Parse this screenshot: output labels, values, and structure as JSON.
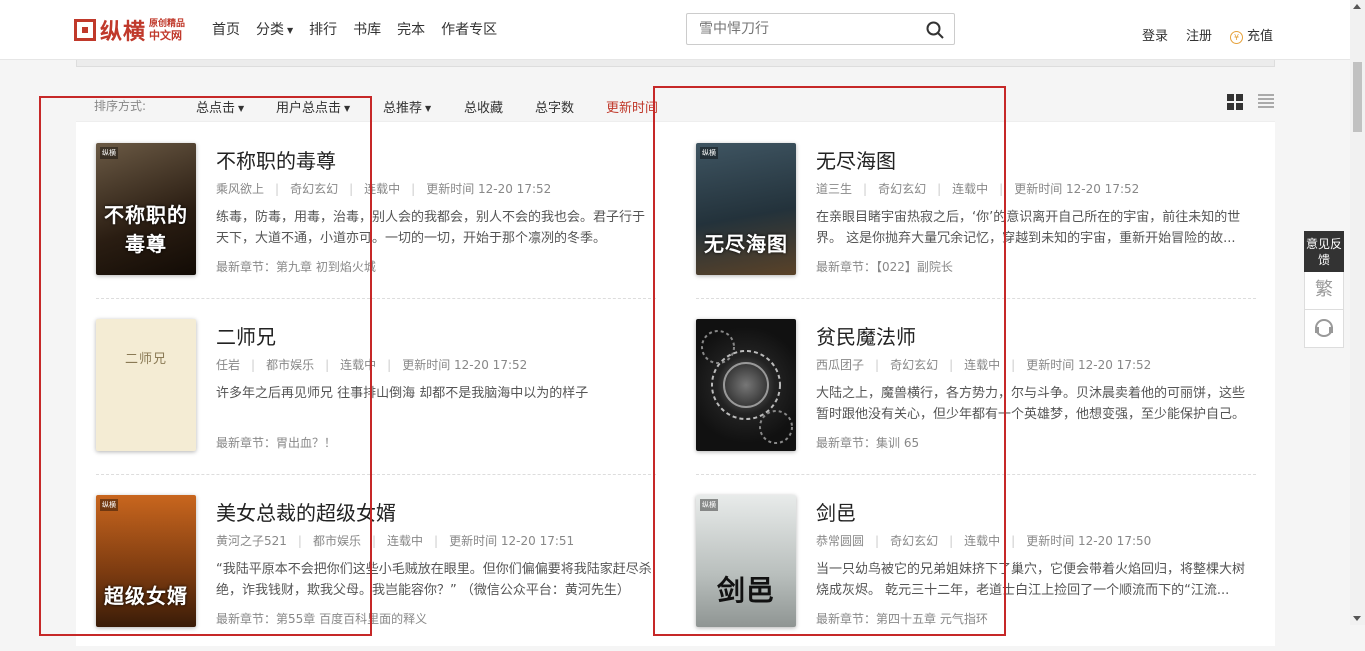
{
  "header": {
    "logo_text": "纵横",
    "logo_sub_1": "原创精品",
    "logo_sub_2": "中文网",
    "nav": [
      {
        "label": "首页"
      },
      {
        "label": "分类",
        "dropdown": true
      },
      {
        "label": "排行"
      },
      {
        "label": "书库"
      },
      {
        "label": "完本"
      },
      {
        "label": "作者专区"
      }
    ],
    "search_placeholder": "雪中悍刀行",
    "login": "登录",
    "register": "注册",
    "recharge": "充值",
    "coin_glyph": "¥"
  },
  "sortbar": {
    "label": "排序方式:",
    "items": [
      {
        "label": "总点击",
        "dropdown": true
      },
      {
        "label": "用户总点击",
        "dropdown": true
      },
      {
        "label": "总推荐",
        "dropdown": true
      },
      {
        "label": "总收藏"
      },
      {
        "label": "总字数"
      },
      {
        "label": "更新时间",
        "active": true
      }
    ]
  },
  "books": [
    {
      "title": "不称职的毒尊",
      "author": "乘风欲上",
      "genre": "奇幻玄幻",
      "status": "连载中",
      "update": "更新时间  12-20 17:52",
      "desc": "练毒，防毒，用毒，治毒，别人会的我都会，别人不会的我也会。君子行于天下，大道不通，小道亦可。一切的一切，开始于那个凛冽的冬季。",
      "latest": "最新章节：第九章 初到焰火城",
      "cover_text": "不称职的毒尊",
      "cover_color": "#3a2a1a"
    },
    {
      "title": "无尽海图",
      "author": "道三生",
      "genre": "奇幻玄幻",
      "status": "连载中",
      "update": "更新时间  12-20 17:52",
      "desc": "在亲眼目睹宇宙热寂之后，‘你’的意识离开自己所在的宇宙，前往未知的世界。 这是你抛弃大量冗余记忆，穿越到未知的宇宙，重新开始冒险的故...",
      "latest": "最新章节：【022】副院长",
      "cover_text": "无尽海图",
      "cover_color": "#2b3a44"
    },
    {
      "title": "二师兄",
      "author": "任岩",
      "genre": "都市娱乐",
      "status": "连载中",
      "update": "更新时间  12-20 17:52",
      "desc": "许多年之后再见师兄 往事排山倒海 却都不是我脑海中以为的样子",
      "latest": "最新章节：胃出血？！",
      "cover_text": "二师兄",
      "cover_color": "#f3ead2"
    },
    {
      "title": "贫民魔法师",
      "author": "西瓜团子",
      "genre": "奇幻玄幻",
      "status": "连载中",
      "update": "更新时间  12-20 17:52",
      "desc": "大陆之上，魔兽横行，各方势力，尔与斗争。贝沐晨卖着他的可丽饼，这些暂时跟他没有关心，但少年都有一个英雄梦，他想变强，至少能保护自己。",
      "latest": "最新章节：集训 65",
      "cover_text": "",
      "cover_color": "#1e1e1e"
    },
    {
      "title": "美女总裁的超级女婿",
      "author": "黄河之子521",
      "genre": "都市娱乐",
      "status": "连载中",
      "update": "更新时间  12-20 17:51",
      "desc": "“我陆平原本不会把你们这些小毛贼放在眼里。但你们偏偏要将我陆家赶尽杀绝，诈我钱财，欺我父母。我岂能容你？” （微信公众平台：黄河先生）",
      "latest": "最新章节：第55章 百度百科里面的释义",
      "cover_text": "超级女婿",
      "cover_color": "#8a4a16"
    },
    {
      "title": "剑邑",
      "author": "恭常圆圆",
      "genre": "奇幻玄幻",
      "status": "连载中",
      "update": "更新时间  12-20 17:50",
      "desc": "当一只幼鸟被它的兄弟姐妹挤下了巢穴，它便会带着火焰回归，将整棵大树烧成灰烬。 乾元三十二年，老道士白江上捡回了一个顺流而下的“江流...",
      "latest": "最新章节：第四十五章 元气指环",
      "cover_text": "剑邑",
      "cover_color": "#cfd3d1"
    }
  ],
  "side_tools": {
    "feedback": "意见反馈",
    "traditional": "繁"
  }
}
